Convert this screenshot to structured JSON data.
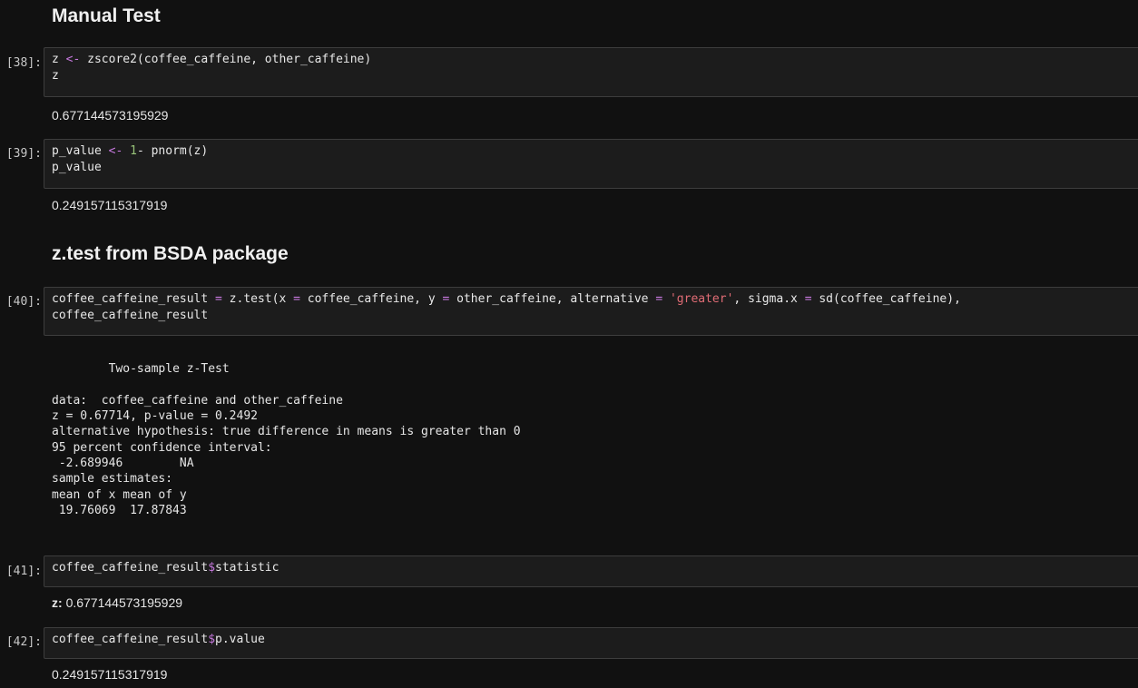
{
  "sections": {
    "manual_test_heading": "Manual Test",
    "ztest_heading": "z.test from BSDA package"
  },
  "cells": [
    {
      "prompt": "[38]:",
      "code_lines": [
        [
          {
            "t": "z "
          },
          {
            "t": "<-",
            "c": "op"
          },
          {
            "t": " zscore2(coffee_caffeine, other_caffeine)"
          }
        ],
        [
          {
            "t": "z"
          }
        ]
      ],
      "output": "0.677144573195929"
    },
    {
      "prompt": "[39]:",
      "code_lines": [
        [
          {
            "t": "p_value "
          },
          {
            "t": "<-",
            "c": "op"
          },
          {
            "t": " "
          },
          {
            "t": "1",
            "c": "num"
          },
          {
            "t": "- pnorm(z)"
          }
        ],
        [
          {
            "t": "p_value"
          }
        ]
      ],
      "output": "0.249157115317919"
    },
    {
      "prompt": "[40]:",
      "code_lines": [
        [
          {
            "t": "coffee_caffeine_result "
          },
          {
            "t": "=",
            "c": "op"
          },
          {
            "t": " z.test(x "
          },
          {
            "t": "=",
            "c": "op"
          },
          {
            "t": " coffee_caffeine, y "
          },
          {
            "t": "=",
            "c": "op"
          },
          {
            "t": " other_caffeine, alternative "
          },
          {
            "t": "=",
            "c": "op"
          },
          {
            "t": " "
          },
          {
            "t": "'greater'",
            "c": "str"
          },
          {
            "t": ", sigma.x "
          },
          {
            "t": "=",
            "c": "op"
          },
          {
            "t": " sd(coffee_caffeine),"
          }
        ],
        [
          {
            "t": "coffee_caffeine_result"
          }
        ]
      ],
      "output_lines": [
        "",
        "\tTwo-sample z-Test",
        "",
        "data:  coffee_caffeine and other_caffeine",
        "z = 0.67714, p-value = 0.2492",
        "alternative hypothesis: true difference in means is greater than 0",
        "95 percent confidence interval:",
        " -2.689946        NA",
        "sample estimates:",
        "mean of x mean of y ",
        " 19.76069  17.87843 "
      ]
    },
    {
      "prompt": "[41]:",
      "code_lines": [
        [
          {
            "t": "coffee_caffeine_result"
          },
          {
            "t": "$",
            "c": "op"
          },
          {
            "t": "statistic"
          }
        ]
      ],
      "output_label": "z:",
      "output": "0.677144573195929"
    },
    {
      "prompt": "[42]:",
      "code_lines": [
        [
          {
            "t": "coffee_caffeine_result"
          },
          {
            "t": "$",
            "c": "op"
          },
          {
            "t": "p.value"
          }
        ]
      ],
      "output": "0.249157115317919"
    }
  ],
  "colors": {
    "background": "#111111",
    "code_background": "#1c1c1c",
    "operator": "#c678dd",
    "number": "#98c379",
    "string": "#e06c75"
  }
}
